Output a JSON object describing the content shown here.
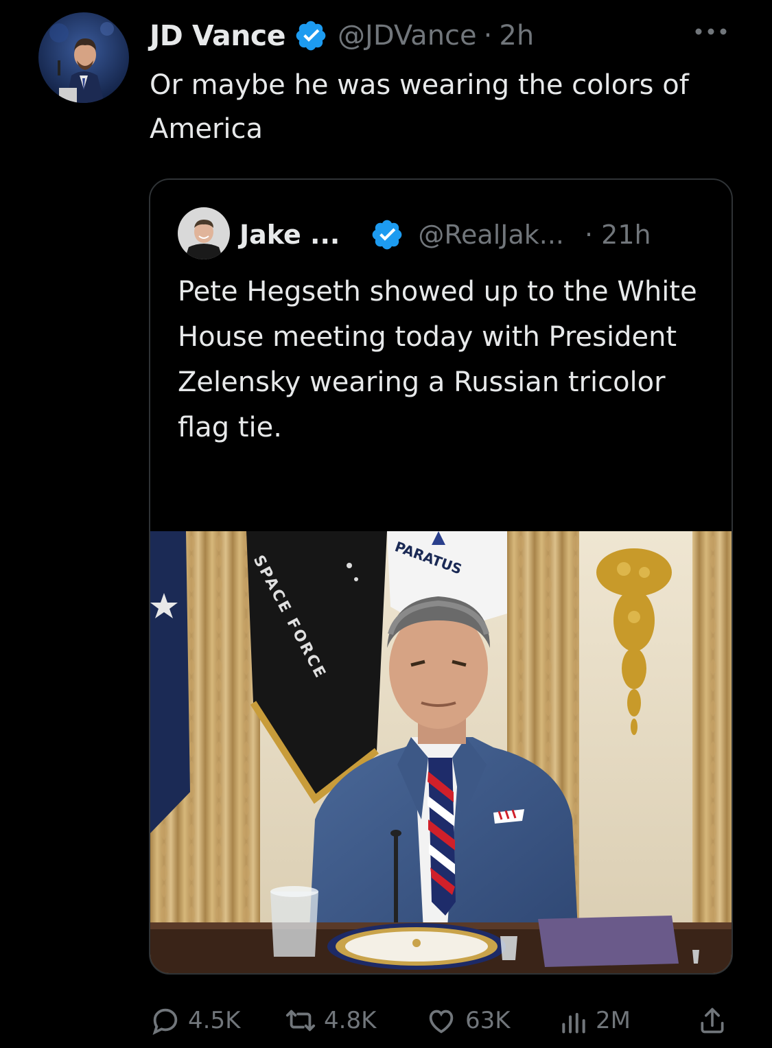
{
  "tweet": {
    "author_name": "JD Vance",
    "handle": "@JDVance",
    "separator": "·",
    "time": "2h",
    "text": "Or maybe he was wearing the colors of America"
  },
  "quoted_tweet": {
    "author_name": "Jake ...",
    "handle": "@RealJak...",
    "time": "· 21h",
    "text": "Pete Hegseth showed up to the White House meeting today with President Zelensky wearing a Russian tricolor flag tie.",
    "ellipsis": "...",
    "image": {
      "flag_texts": [
        "SPACE FORCE",
        "PARATUS"
      ]
    }
  },
  "actions": {
    "replies": "4.5K",
    "reposts": "4.8K",
    "likes": "63K",
    "views": "2M"
  },
  "colors": {
    "background": "#000000",
    "text_primary": "#e7e9ea",
    "text_secondary": "#71767b",
    "verified_blue": "#1d9bf0",
    "border": "#2f3336"
  },
  "icons": {
    "verified": "verified-badge-icon",
    "more": "more-icon",
    "reply": "reply-icon",
    "repost": "repost-icon",
    "like": "like-icon",
    "views": "views-icon",
    "share": "share-icon"
  }
}
